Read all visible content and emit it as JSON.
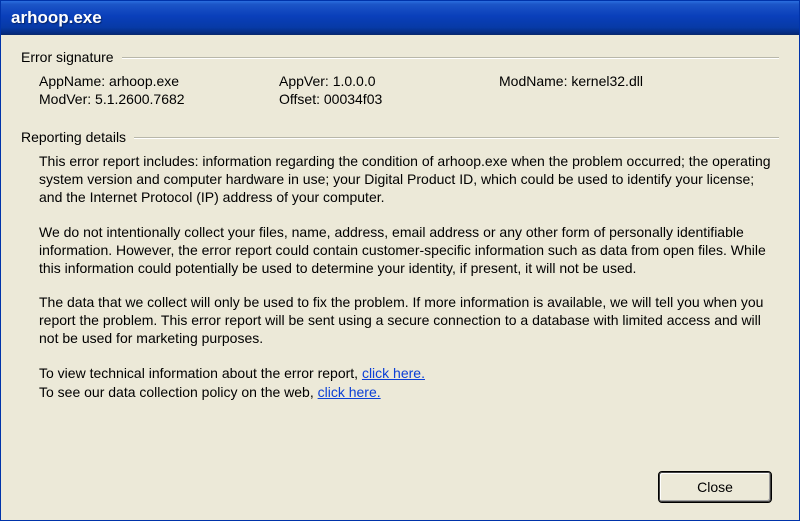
{
  "window": {
    "title": "arhoop.exe"
  },
  "error_signature": {
    "legend": "Error signature",
    "app_name_label": "AppName: arhoop.exe",
    "app_ver_label": "AppVer: 1.0.0.0",
    "mod_name_label": "ModName: kernel32.dll",
    "mod_ver_label": "ModVer: 5.1.2600.7682",
    "offset_label": "Offset: 00034f03"
  },
  "reporting": {
    "legend": "Reporting details",
    "p1": "This error report includes: information regarding the condition of arhoop.exe when the problem occurred; the operating system version and computer hardware in use; your Digital Product ID, which could be used to identify your license; and the Internet Protocol (IP) address of your computer.",
    "p2": "We do not intentionally collect your files, name, address, email address or any other form of personally identifiable information. However, the error report could contain customer-specific information such as data from open files. While this information could potentially be used to determine your identity, if present, it will not be used.",
    "p3": "The data that we collect will only be used to fix the problem. If more information is available, we will tell you when you report the problem. This error report will be sent using a secure connection to a database with limited access and will not be used for marketing purposes.",
    "tech_line_prefix": "To view technical information about the error report, ",
    "tech_link": "click here.",
    "policy_line_prefix": "To see our data collection policy on the web, ",
    "policy_link": "click here."
  },
  "buttons": {
    "close": "Close"
  }
}
